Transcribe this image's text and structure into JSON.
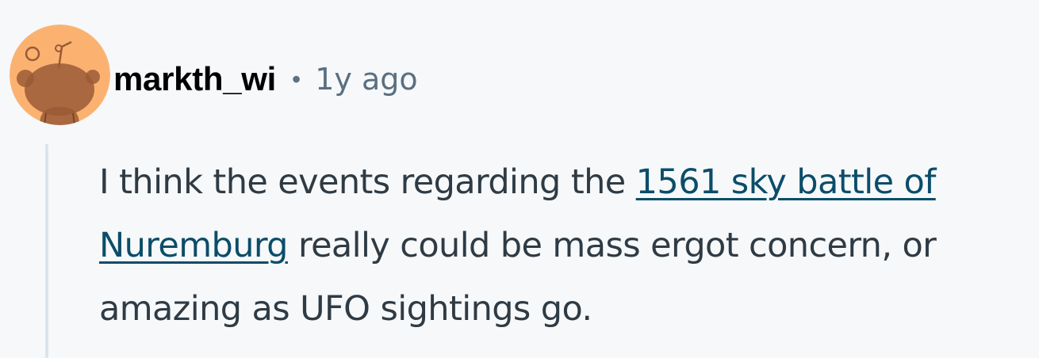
{
  "comment": {
    "author": "markth_wi",
    "separator": "•",
    "timestamp": "1y ago",
    "avatar_icon": "snoo-avatar-icon",
    "colors": {
      "avatar_bg": "#fbb271",
      "snoo": "#9a5b36",
      "link": "#0b4d69",
      "text": "#2f3b44",
      "meta": "#5a6f80",
      "thread_line": "#dbe4ee",
      "background": "#f6f8fa"
    },
    "body": {
      "before_link": "I think the events regarding the ",
      "link_text": "1561 sky battle of Nuremburg",
      "after_link": " really could be mass ergot concern, or amazing as UFO sightings go."
    }
  }
}
